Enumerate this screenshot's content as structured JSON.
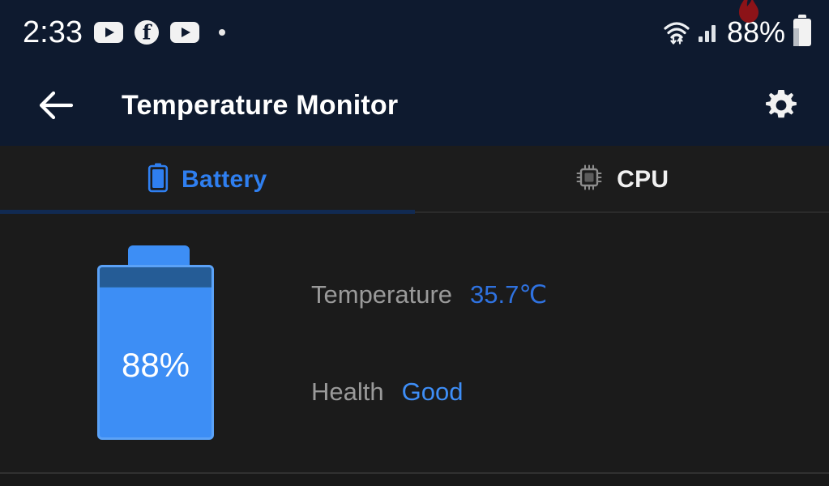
{
  "statusbar": {
    "clock": "2:33",
    "icons_left": [
      "youtube-icon",
      "facebook-icon",
      "youtube-icon",
      "dot-icon"
    ],
    "facebook_glyph": "f",
    "icons_right": [
      "wifi-icon",
      "signal-icon",
      "battery-icon",
      "flame-icon"
    ],
    "battery_percent": "88%"
  },
  "appbar": {
    "back_icon": "back-arrow-icon",
    "title": "Temperature Monitor",
    "settings_icon": "gear-icon"
  },
  "tabs": [
    {
      "id": "battery",
      "label": "Battery",
      "icon": "battery-icon",
      "active": true
    },
    {
      "id": "cpu",
      "label": "CPU",
      "icon": "cpu-chip-icon",
      "active": false
    }
  ],
  "battery_card": {
    "level_label": "88%",
    "level_percent": 88,
    "fill_color": "#3d8ef5",
    "empty_color": "#255c96",
    "border_color": "#5ba2f7"
  },
  "info": {
    "temperature": {
      "label": "Temperature",
      "value": "35.7℃"
    },
    "health": {
      "label": "Health",
      "value": "Good"
    }
  },
  "colors": {
    "appbar_bg": "#0e1a2f",
    "content_bg": "#1b1b1b",
    "tabbar_bg": "#1c1c1c",
    "accent_blue": "#2f7ff0",
    "muted_text": "#9a9a9a"
  }
}
